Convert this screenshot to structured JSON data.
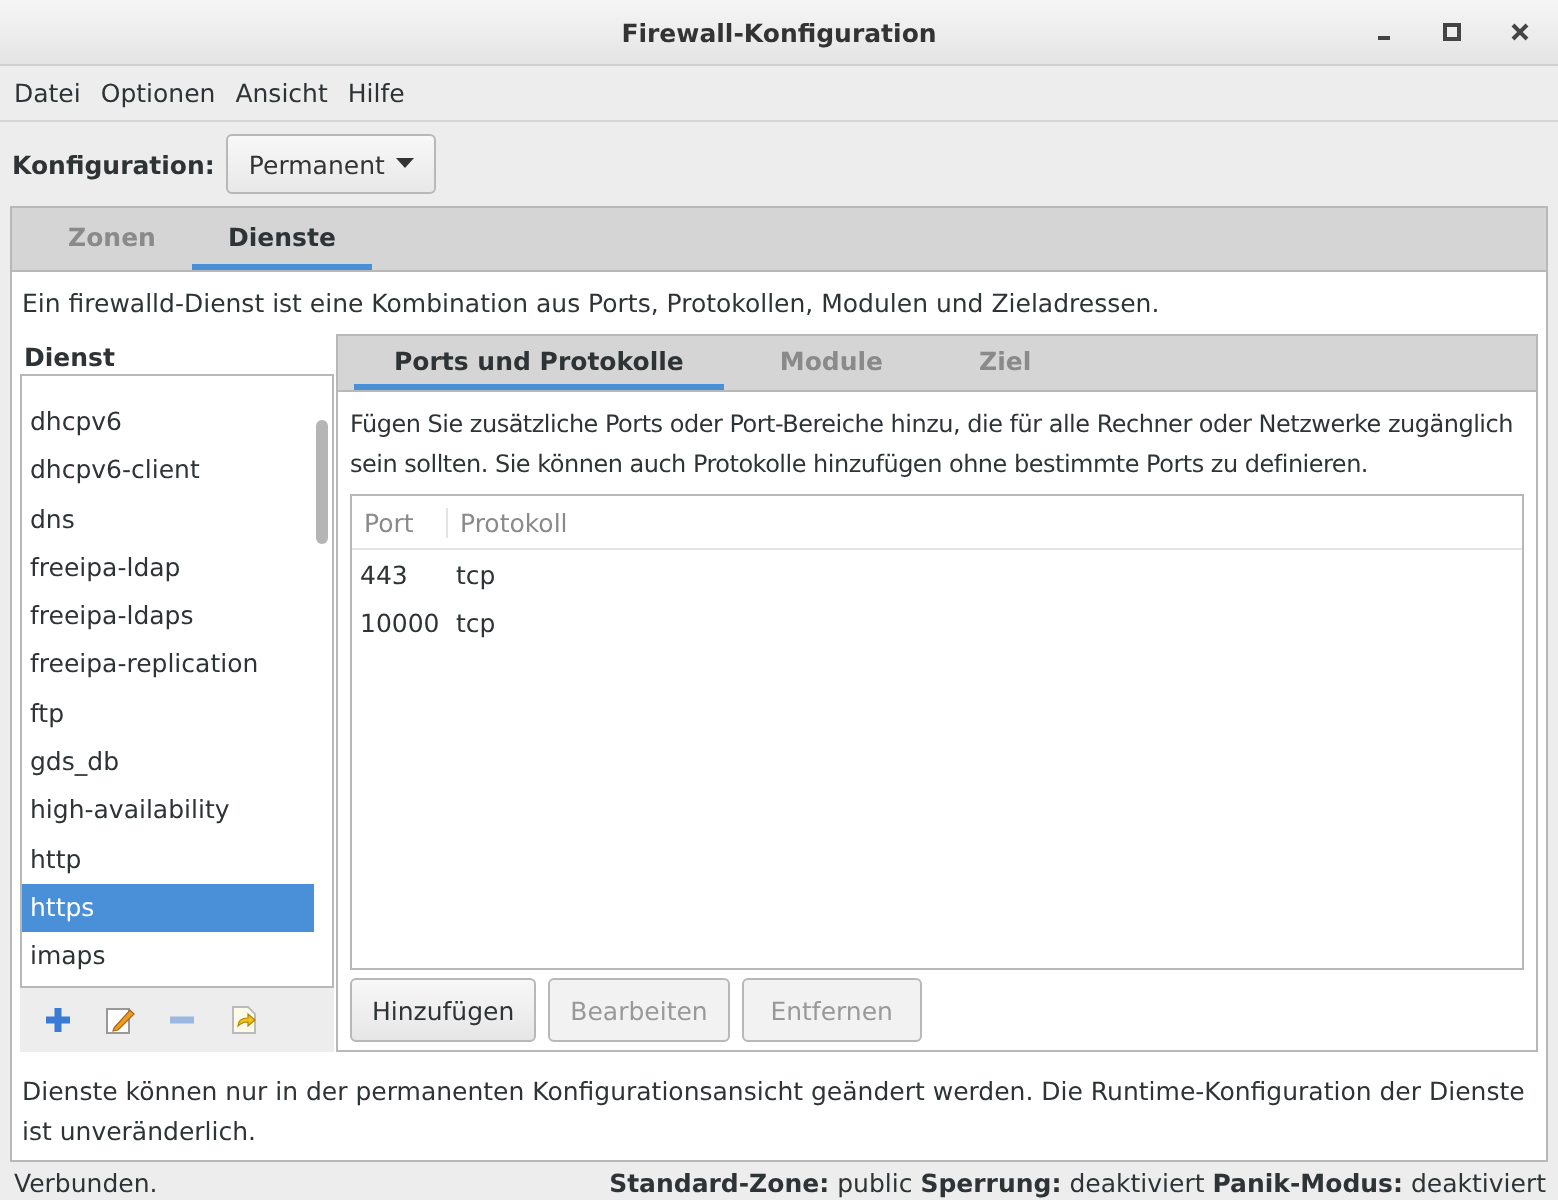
{
  "window": {
    "title": "Firewall-Konfiguration"
  },
  "menu": [
    "Datei",
    "Optionen",
    "Ansicht",
    "Hilfe"
  ],
  "configuration": {
    "label": "Konfiguration:",
    "value": "Permanent"
  },
  "tabs": [
    {
      "label": "Zonen",
      "selected": false
    },
    {
      "label": "Dienste",
      "selected": true
    }
  ],
  "description": "Ein firewalld-Dienst ist eine Kombination aus Ports, Protokollen, Modulen und Zieladressen.",
  "service_list": {
    "heading": "Dienst",
    "items": [
      {
        "label": "dhcpv6",
        "selected": false
      },
      {
        "label": "dhcpv6-client",
        "selected": false
      },
      {
        "label": "dns",
        "selected": false
      },
      {
        "label": "freeipa-ldap",
        "selected": false
      },
      {
        "label": "freeipa-ldaps",
        "selected": false
      },
      {
        "label": "freeipa-replication",
        "selected": false
      },
      {
        "label": "ftp",
        "selected": false
      },
      {
        "label": "gds_db",
        "selected": false
      },
      {
        "label": "high-availability",
        "selected": false
      },
      {
        "label": "http",
        "selected": false
      },
      {
        "label": "https",
        "selected": true
      },
      {
        "label": "imaps",
        "selected": false
      }
    ]
  },
  "inner_tabs": [
    {
      "label": "Ports und Protokolle",
      "selected": true
    },
    {
      "label": "Module",
      "selected": false
    },
    {
      "label": "Ziel",
      "selected": false
    }
  ],
  "ports_hint": "Fügen Sie zusätzliche Ports oder Port-Bereiche hinzu, die für alle Rechner oder Netzwerke zugänglich sein sollten. Sie können auch Protokolle hinzufügen ohne bestimmte Ports zu definieren.",
  "table": {
    "columns": [
      "Port",
      "Protokoll"
    ],
    "rows": [
      [
        "443",
        "tcp"
      ],
      [
        "10000",
        "tcp"
      ]
    ]
  },
  "buttons": [
    {
      "label": "Hinzufügen",
      "disabled": false
    },
    {
      "label": "Bearbeiten",
      "disabled": true
    },
    {
      "label": "Entfernen",
      "disabled": true
    }
  ],
  "note": "Dienste können nur in der permanenten Konfigurationsansicht geändert werden. Die Runtime-Konfiguration der Dienste ist unveränderlich.",
  "status_bar": {
    "message": "Verbunden.",
    "fields": [
      {
        "label": "Standard-Zone:",
        "value": "public"
      },
      {
        "label": "Sperrung:",
        "value": "deaktiviert"
      },
      {
        "label": "Panik-Modus:",
        "value": "deaktiviert"
      }
    ]
  }
}
